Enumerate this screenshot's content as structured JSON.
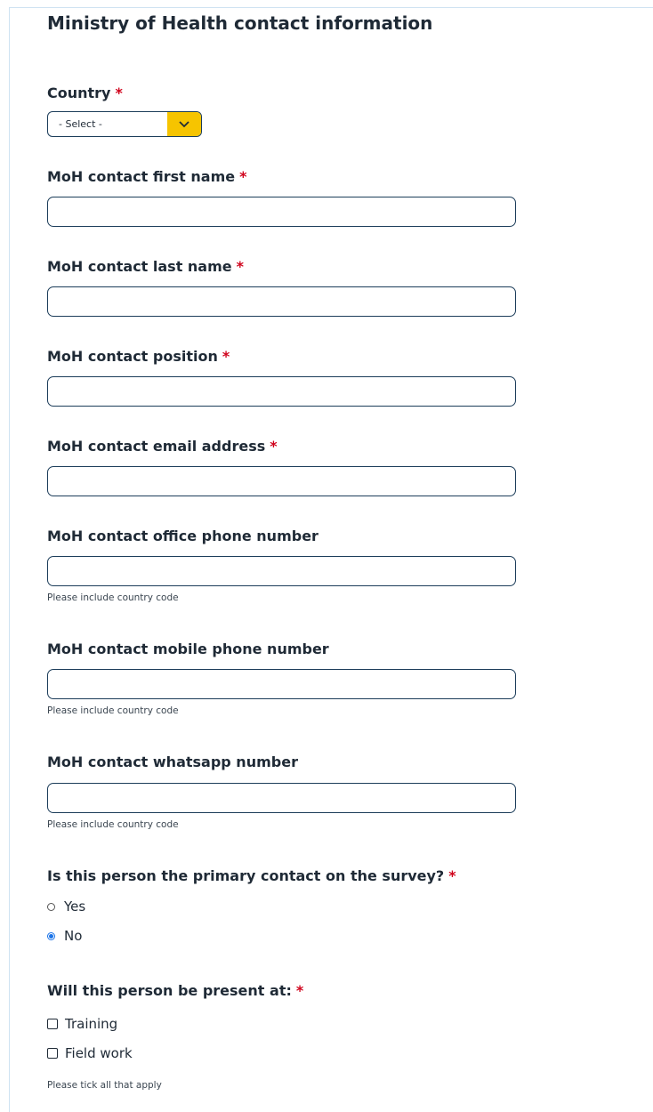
{
  "section": {
    "title": "Ministry of Health contact information"
  },
  "required_marker": "*",
  "country": {
    "label": "Country",
    "selected": "- Select -"
  },
  "fields": [
    {
      "label": "MoH contact first name",
      "value": ""
    },
    {
      "label": "MoH contact last name",
      "value": ""
    },
    {
      "label": "MoH contact position",
      "value": ""
    },
    {
      "label": "MoH contact email address",
      "value": ""
    },
    {
      "label": "MoH contact office phone number",
      "value": "",
      "hint": "Please include country code"
    },
    {
      "label": "MoH contact mobile phone number",
      "value": "",
      "hint": "Please include country code"
    },
    {
      "label": "MoH contact whatsapp number",
      "value": "",
      "hint": "Please include country code"
    }
  ],
  "primary_contact": {
    "label": "Is this person the primary contact on the survey?",
    "options": [
      "Yes",
      "No"
    ],
    "selected": "No"
  },
  "presence": {
    "label": "Will this person be present at:",
    "options": [
      "Training",
      "Field work"
    ],
    "hint": "Please tick all that apply"
  },
  "colors": {
    "required": "#d0021b",
    "select_button": "#f6c400",
    "border": "#1c3d5a",
    "radio_selected": "#1a73e8"
  },
  "icons": {
    "select": "chevron-down-icon"
  }
}
